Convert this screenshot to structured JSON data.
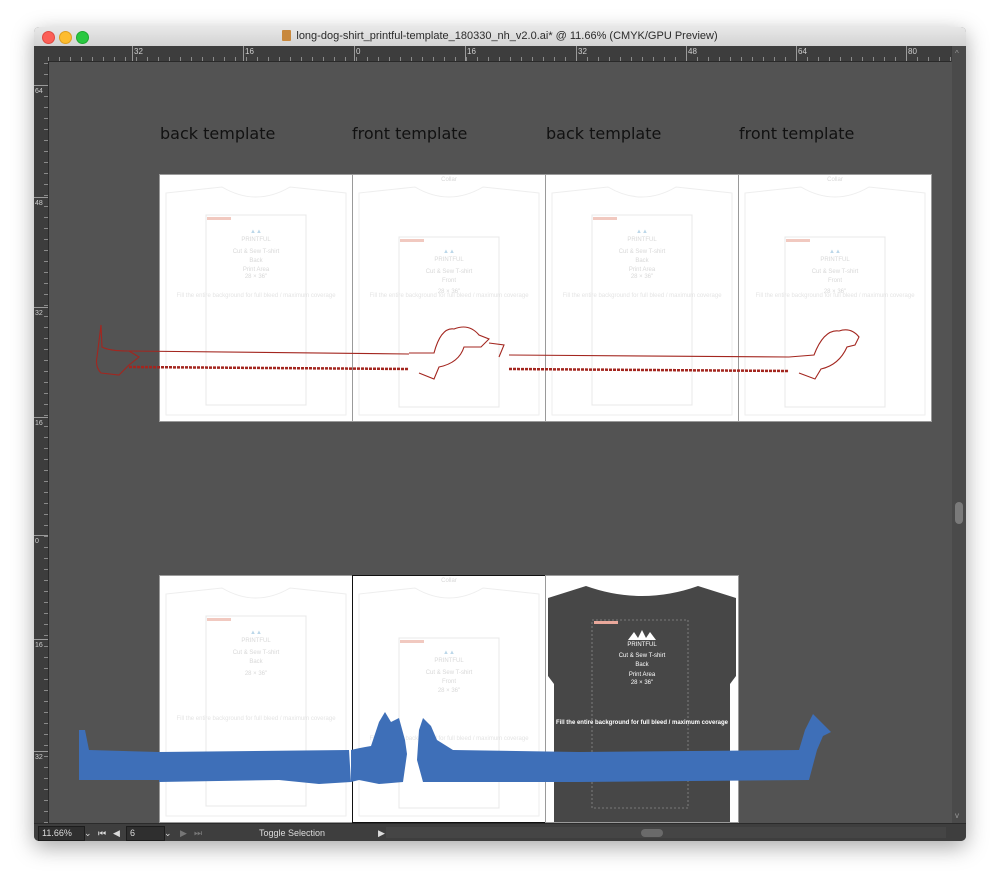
{
  "window": {
    "title": "long-dog-shirt_printful-template_180330_nh_v2.0.ai* @ 11.66% (CMYK/GPU Preview)"
  },
  "ruler": {
    "h_ticks": [
      "32",
      "16",
      "0",
      "16",
      "32",
      "48",
      "64",
      "80"
    ],
    "v_ticks": [
      "64",
      "48",
      "32",
      "16",
      "0",
      "16",
      "32"
    ]
  },
  "labels": [
    "back template",
    "front template",
    "back template",
    "front template"
  ],
  "template": {
    "brand": "PRINTFUL",
    "product": "Cut & Sew T-shirt",
    "side_back": "Back",
    "side_front": "Front",
    "print_area_label": "Print Area",
    "print_area_value": "28 × 36\"",
    "fill_text": "Fill the entire background for full bleed / maximum coverage",
    "collar": "Collar",
    "note": "NOTE: Your art must cover whole template"
  },
  "status": {
    "zoom": "11.66%",
    "artboard": "6",
    "mode": "Toggle Selection"
  },
  "colors": {
    "canvas": "#535353",
    "dog_red": "#a3261f",
    "dog_blue": "#3e6fb8",
    "dark_shirt": "#474747"
  }
}
